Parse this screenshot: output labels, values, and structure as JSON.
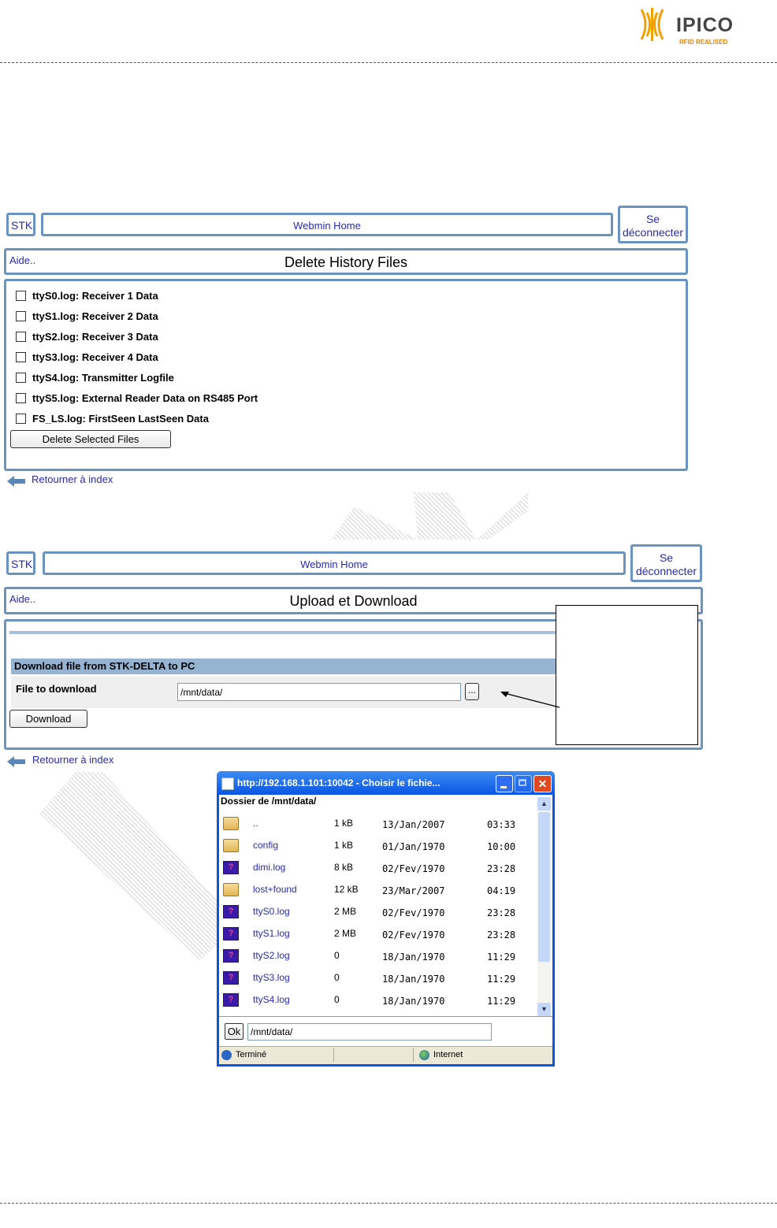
{
  "header": {
    "logo_text": "IPICO",
    "logo_sub": "RFID REALISED"
  },
  "panel1": {
    "nav": {
      "stk": "STK",
      "home": "Webmin Home",
      "logout_line1": "Se",
      "logout_line2": "déconnecter"
    },
    "help": "Aide..",
    "title": "Delete History Files",
    "files": [
      "ttyS0.log: Receiver 1 Data",
      "ttyS1.log: Receiver 2 Data",
      "ttyS2.log: Receiver 3 Data",
      "ttyS3.log: Receiver 4 Data",
      "ttyS4.log: Transmitter Logfile",
      "ttyS5.log: External Reader Data on RS485 Port",
      "FS_LS.log: FirstSeen LastSeen Data"
    ],
    "delete_button": "Delete Selected Files",
    "back": "Retourner à index"
  },
  "panel2": {
    "nav": {
      "stk": "STK",
      "home": "Webmin Home",
      "logout_line1": "Se",
      "logout_line2": "déconnecter"
    },
    "help": "Aide..",
    "title": "Upload et Download",
    "section_title": "Download file from STK-DELTA to PC",
    "field_label": "File to download",
    "field_value": "/mnt/data/",
    "browse_label": "...",
    "download_button": "Download",
    "back": "Retourner à index"
  },
  "popup": {
    "title": "http://192.168.1.101:10042 - Choisir le fichie...",
    "folder_label": "Dossier de /mnt/data/",
    "files": [
      {
        "name": "..",
        "size": "1 kB",
        "date": "13/Jan/2007",
        "time": "03:33",
        "icon": "folder-icon"
      },
      {
        "name": "config",
        "size": "1 kB",
        "date": "01/Jan/1970",
        "time": "10:00",
        "icon": "folder-icon"
      },
      {
        "name": "dimi.log",
        "size": "8 kB",
        "date": "02/Fev/1970",
        "time": "23:28",
        "icon": "unknown-file-icon"
      },
      {
        "name": "lost+found",
        "size": "12 kB",
        "date": "23/Mar/2007",
        "time": "04:19",
        "icon": "folder-icon"
      },
      {
        "name": "ttyS0.log",
        "size": "2 MB",
        "date": "02/Fev/1970",
        "time": "23:28",
        "icon": "unknown-file-icon"
      },
      {
        "name": "ttyS1.log",
        "size": "2 MB",
        "date": "02/Fev/1970",
        "time": "23:28",
        "icon": "unknown-file-icon"
      },
      {
        "name": "ttyS2.log",
        "size": "0",
        "date": "18/Jan/1970",
        "time": "11:29",
        "icon": "unknown-file-icon"
      },
      {
        "name": "ttyS3.log",
        "size": "0",
        "date": "18/Jan/1970",
        "time": "11:29",
        "icon": "unknown-file-icon"
      },
      {
        "name": "ttyS4.log",
        "size": "0",
        "date": "18/Jan/1970",
        "time": "11:29",
        "icon": "unknown-file-icon"
      }
    ],
    "ok_button": "Ok",
    "path_value": "/mnt/data/",
    "status_done": "Terminé",
    "status_zone": "Internet"
  }
}
